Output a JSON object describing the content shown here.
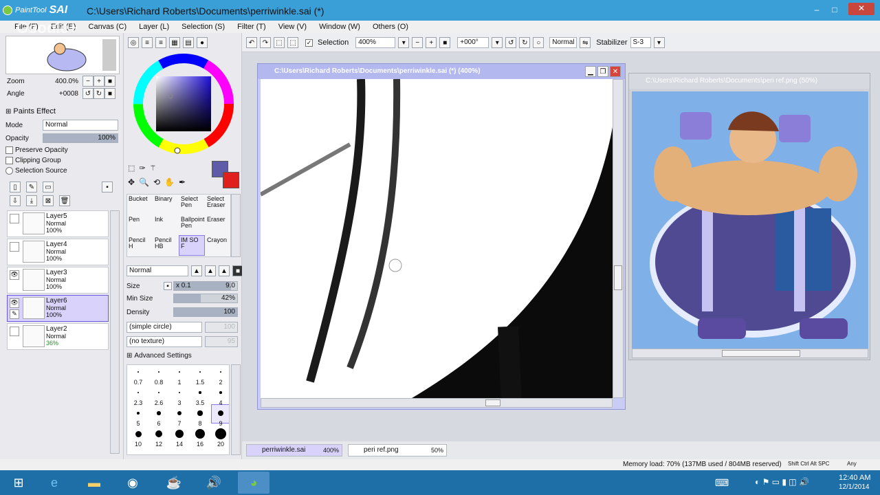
{
  "app": {
    "logo_small": "PaintTool",
    "logo_big": "SAI",
    "title": "C:\\Users\\Richard Roberts\\Documents\\perriwinkle.sai (*)",
    "watermark": "Google+"
  },
  "window_buttons": {
    "minimize": "‒",
    "maximize": "□",
    "close": "✕"
  },
  "menu": [
    "File (F)",
    "Edit (E)",
    "Canvas (C)",
    "Layer (L)",
    "Selection (S)",
    "Filter (T)",
    "View (V)",
    "Window (W)",
    "Others (O)"
  ],
  "navigator": {
    "zoom_label": "Zoom",
    "zoom_value": "400.0%",
    "angle_label": "Angle",
    "angle_value": "+0008"
  },
  "paints_effect": {
    "header": "Paints Effect",
    "mode_label": "Mode",
    "mode_value": "Normal",
    "opacity_label": "Opacity",
    "opacity_value": "100%",
    "opacity_level": 1.0,
    "preserve_opacity": "Preserve Opacity",
    "clipping_group": "Clipping Group",
    "selection_source": "Selection Source"
  },
  "layers": [
    {
      "name": "Layer5",
      "mode": "Normal",
      "opacity": "100%",
      "visible": false,
      "active": false
    },
    {
      "name": "Layer4",
      "mode": "Normal",
      "opacity": "100%",
      "visible": false,
      "active": false
    },
    {
      "name": "Layer3",
      "mode": "Normal",
      "opacity": "100%",
      "visible": true,
      "active": false
    },
    {
      "name": "Layer6",
      "mode": "Normal",
      "opacity": "100%",
      "visible": true,
      "active": true
    },
    {
      "name": "Layer2",
      "mode": "Normal",
      "opacity": "36%",
      "visible": false,
      "active": false
    }
  ],
  "colors": {
    "primary": "#5e5ba8",
    "secondary": "#e0201c",
    "accent": "#3a9fd6",
    "selected": "#d9d3fb"
  },
  "tools": [
    {
      "l1": "Bucket",
      "l2": ""
    },
    {
      "l1": "Binary",
      "l2": ""
    },
    {
      "l1": "Select",
      "l2": "Pen"
    },
    {
      "l1": "Select",
      "l2": "Eraser"
    },
    {
      "l1": "Pen",
      "l2": ""
    },
    {
      "l1": "Ink",
      "l2": ""
    },
    {
      "l1": "Ballpoint",
      "l2": "Pen"
    },
    {
      "l1": "Eraser",
      "l2": ""
    },
    {
      "l1": "Pencil",
      "l2": "H"
    },
    {
      "l1": "Pencil",
      "l2": "HB"
    },
    {
      "l1": "IM SO F",
      "l2": ""
    },
    {
      "l1": "Crayon",
      "l2": ""
    }
  ],
  "brush": {
    "blend_mode": "Normal",
    "size_label": "Size",
    "size_mult": "x 0.1",
    "size_value": "9.0",
    "size_level": 0.9,
    "min_size_label": "Min Size",
    "min_size_value": "42%",
    "min_size_level": 0.42,
    "density_label": "Density",
    "density_value": "100",
    "density_level": 1.0,
    "shape": "(simple circle)",
    "shape_value": "100",
    "texture": "(no texture)",
    "texture_value": "95",
    "advanced": "Advanced Settings",
    "sizes": [
      "0.7",
      "0.8",
      "1",
      "1.5",
      "2",
      "2.3",
      "2.6",
      "3",
      "3.5",
      "4",
      "5",
      "6",
      "7",
      "8",
      "9",
      "10",
      "12",
      "14",
      "16",
      "20"
    ]
  },
  "toolbar": {
    "selection_label": "Selection",
    "zoom": "400%",
    "angle": "+000°",
    "blend": "Normal",
    "stabilizer_label": "Stabilizer",
    "stabilizer_value": "S-3"
  },
  "canvas_window": {
    "title": "C:\\Users\\Richard Roberts\\Documents\\perriwinkle.sai (*) (400%)"
  },
  "ref_window": {
    "title": "C:\\Users\\Richard Roberts\\Documents\\peri ref.png (50%)"
  },
  "tabs": [
    {
      "name": "perriwinkle.sai",
      "zoom": "400%",
      "active": true
    },
    {
      "name": "peri ref.png",
      "zoom": "50%",
      "active": false
    }
  ],
  "status": {
    "memory": "Memory load: 70% (137MB used / 804MB reserved)",
    "keys": "Shift Ctrl Alt SPC",
    "any": "Any"
  },
  "clock": {
    "time": "12:40 AM",
    "date": "12/1/2014"
  },
  "taskbar_icons": [
    "windows-start",
    "internet-explorer",
    "file-explorer",
    "chrome",
    "java",
    "speaker",
    "paint-tool-sai"
  ]
}
